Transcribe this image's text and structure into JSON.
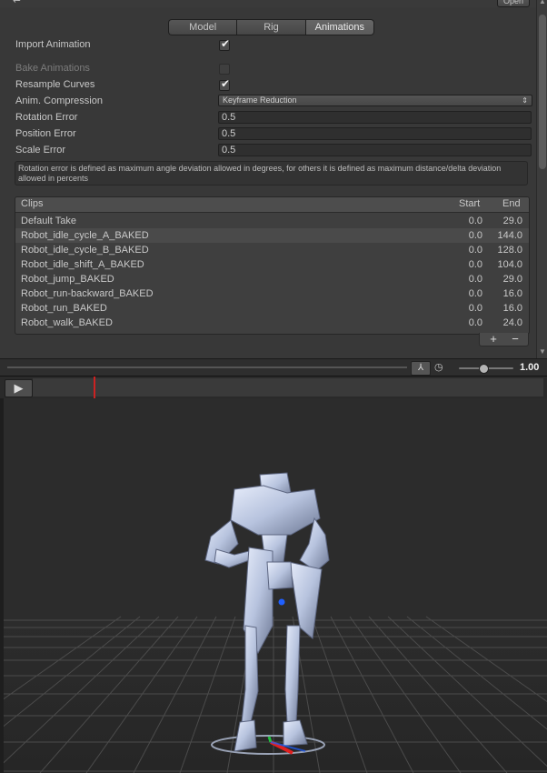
{
  "header": {
    "back_glyph": "↩",
    "open_label": "Open"
  },
  "tabs": [
    {
      "label": "Model",
      "active": false
    },
    {
      "label": "Rig",
      "active": false
    },
    {
      "label": "Animations",
      "active": true
    }
  ],
  "settings": {
    "import_animation": {
      "label": "Import Animation",
      "checked": true
    },
    "bake_animations": {
      "label": "Bake Animations",
      "checked": false,
      "disabled": true
    },
    "resample_curves": {
      "label": "Resample Curves",
      "checked": true
    },
    "anim_compression": {
      "label": "Anim. Compression",
      "value": "Keyframe Reduction"
    },
    "rotation_error": {
      "label": "Rotation Error",
      "value": "0.5"
    },
    "position_error": {
      "label": "Position Error",
      "value": "0.5"
    },
    "scale_error": {
      "label": "Scale Error",
      "value": "0.5"
    },
    "help_text": "Rotation error is defined as maximum angle deviation allowed in degrees, for others it is defined as maximum distance/delta deviation allowed in percents"
  },
  "clips": {
    "header": {
      "name": "Clips",
      "start": "Start",
      "end": "End"
    },
    "rows": [
      {
        "name": "Default Take",
        "start": "0.0",
        "end": "29.0"
      },
      {
        "name": "Robot_idle_cycle_A_BAKED",
        "start": "0.0",
        "end": "144.0"
      },
      {
        "name": "Robot_idle_cycle_B_BAKED",
        "start": "0.0",
        "end": "128.0"
      },
      {
        "name": "Robot_idle_shift_A_BAKED",
        "start": "0.0",
        "end": "104.0"
      },
      {
        "name": "Robot_jump_BAKED",
        "start": "0.0",
        "end": "29.0"
      },
      {
        "name": "Robot_run-backward_BAKED",
        "start": "0.0",
        "end": "16.0"
      },
      {
        "name": "Robot_run_BAKED",
        "start": "0.0",
        "end": "16.0"
      },
      {
        "name": "Robot_walk_BAKED",
        "start": "0.0",
        "end": "24.0"
      }
    ],
    "selected_index": 1,
    "add_label": "+",
    "remove_label": "−"
  },
  "preview": {
    "pivot_glyph": "⅄",
    "speed_glyph": "◷",
    "speed_value": "1.00",
    "speed_fraction": 0.45,
    "play_glyph": "▶",
    "playhead_fraction": 0.12
  },
  "colors": {
    "panel": "#383838",
    "playhead": "#cc2222",
    "robot": "#b7c3de",
    "axis_x": "#e02020",
    "axis_y": "#20c040",
    "axis_z": "#2060ff"
  }
}
